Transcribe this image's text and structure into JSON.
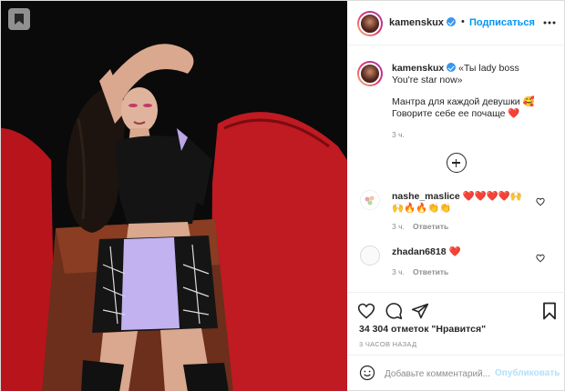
{
  "header": {
    "username": "kamenskux",
    "separator": "•",
    "follow_label": "Подписаться",
    "more_icon": "more-horizontal-icon"
  },
  "caption": {
    "username": "kamenskux",
    "line1": "«Ты lady boss",
    "line2": "You're star now»",
    "line3": "Мантра для каждой девушки 🥰",
    "line4": "Говорите себе ее почаще ❤️",
    "time": "3 ч."
  },
  "comments": [
    {
      "username": "nashe_maslice",
      "text_line1": "❤️❤️❤️❤️🙌",
      "text_line2": "🙌🔥🔥👏👏",
      "time": "3 ч.",
      "reply_label": "Ответить"
    },
    {
      "username": "zhadan6818",
      "text_line1": "❤️",
      "time": "3 ч.",
      "reply_label": "Ответить"
    }
  ],
  "likes_text": "34 304 отметок \"Нравится\"",
  "posted_ago": "3 ЧАСОВ НАЗАД",
  "add_comment": {
    "placeholder": "Добавьте комментарий...",
    "publish_label": "Опубликовать"
  },
  "colors": {
    "accent": "#0095f6",
    "verified": "#3897f0",
    "publish_disabled": "#b2dffc",
    "muted": "#8e8e8e"
  }
}
